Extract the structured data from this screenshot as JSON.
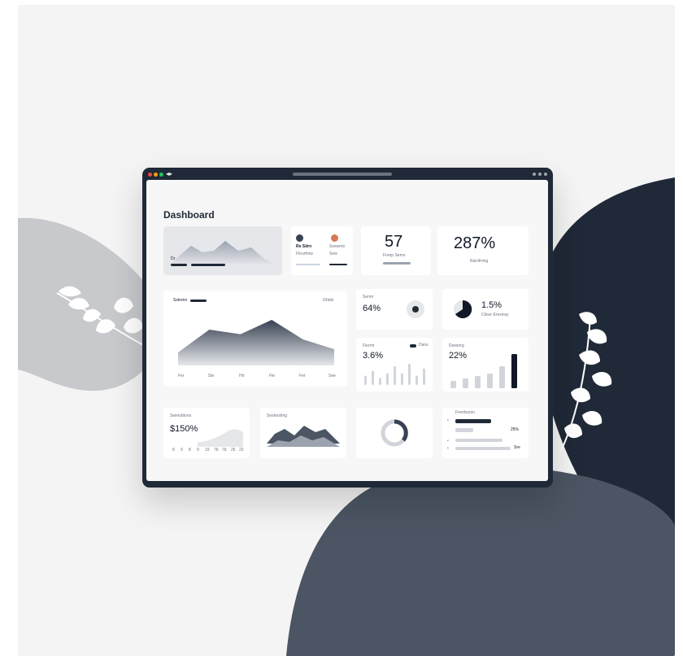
{
  "window": {
    "nav_icon": "back-forward-arrows-icon"
  },
  "dashboard": {
    "title": "Dashboard",
    "hero": {
      "label": "Dr"
    },
    "profile_card": {
      "left_name": "Re Sdrn",
      "left_sub": "Flourfrow",
      "right_name": "Ssewres",
      "right_sub": "Sew"
    },
    "stat_57": {
      "value": "57",
      "label": "Frenp Sernx"
    },
    "stat_287": {
      "value": "287%",
      "label": "Rarnfrring"
    },
    "main_chart": {
      "title": "Sstrenn",
      "right_label": "Ghtdx",
      "ticks": [
        "Fer",
        "Sle",
        "Hrt",
        "Fie",
        "Fet",
        "See"
      ]
    },
    "pct_64": {
      "label": "Senrn",
      "value": "64%"
    },
    "pct_15": {
      "value": "1.5%",
      "label": "Ctlser Eresinsy"
    },
    "rate_36": {
      "label": "Fierrnt",
      "value": "3.6%",
      "legend": "Dans"
    },
    "rate_22": {
      "label": "Dsesnrg",
      "value": "22%"
    },
    "sales": {
      "label": "Swreuttions",
      "value": "$150%",
      "ticks": [
        "8",
        "9",
        "8",
        "9",
        "19",
        "7b",
        "7b",
        "26",
        "22"
      ]
    },
    "area_small": {
      "label": "Sestresting"
    },
    "progress": {
      "label": "Frerdssrsn",
      "value_a": "25%",
      "value_b": "Sre"
    }
  },
  "chart_data": [
    {
      "type": "area",
      "name": "main_chart",
      "categories": [
        "Fer",
        "Sle",
        "Hrt",
        "Fie",
        "Fet",
        "See"
      ],
      "values": [
        20,
        55,
        48,
        70,
        40,
        25
      ]
    },
    {
      "type": "bar",
      "name": "rate_36_bars",
      "values": [
        4,
        6,
        3,
        5,
        8,
        5,
        9,
        4,
        7
      ]
    },
    {
      "type": "bar",
      "name": "rate_22_bars",
      "values": [
        3,
        4,
        5,
        6,
        9,
        14
      ]
    }
  ]
}
